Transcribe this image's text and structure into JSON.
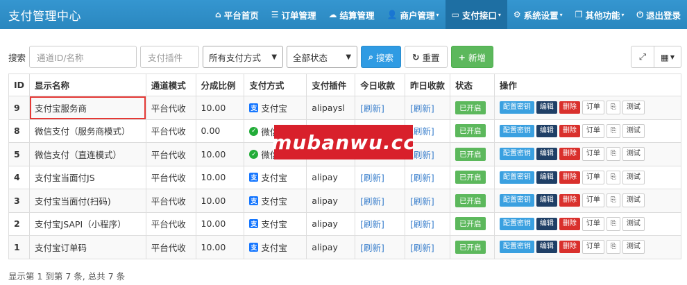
{
  "app": {
    "title": "支付管理中心"
  },
  "nav": [
    {
      "icon": "home-icon",
      "glyph": "⌂",
      "label": "平台首页",
      "caret": false
    },
    {
      "icon": "list-icon",
      "glyph": "☰",
      "label": "订单管理",
      "caret": false
    },
    {
      "icon": "cloud-icon",
      "glyph": "☁",
      "label": "结算管理",
      "caret": false
    },
    {
      "icon": "user-icon",
      "glyph": "👤",
      "label": "商户管理",
      "caret": true
    },
    {
      "icon": "credit-card-icon",
      "glyph": "▭",
      "label": "支付接口",
      "caret": true
    },
    {
      "icon": "gear-icon",
      "glyph": "⚙",
      "label": "系统设置",
      "caret": true
    },
    {
      "icon": "cube-icon",
      "glyph": "❒",
      "label": "其他功能",
      "caret": true
    },
    {
      "icon": "power-icon",
      "glyph": "⏻",
      "label": "退出登录",
      "caret": false
    }
  ],
  "toolbar": {
    "search_label": "搜索",
    "channel_placeholder": "通道ID/名称",
    "plugin_placeholder": "支付插件",
    "method_select": "所有支付方式",
    "status_select": "全部状态",
    "search_btn": "搜索",
    "reset_btn": "重置",
    "add_btn": "新增"
  },
  "table": {
    "headers": [
      "ID",
      "显示名称",
      "通道模式",
      "分成比例",
      "支付方式",
      "支付插件",
      "今日收款",
      "昨日收款",
      "状态",
      "操作"
    ],
    "rows": [
      {
        "id": "9",
        "name": "支付宝服务商",
        "mode": "平台代收",
        "ratio": "10.00",
        "pay": "支付宝",
        "pay_type": "alipay",
        "plugin": "alipaysl",
        "today": "[刷新]",
        "yesterday": "[刷新]",
        "status": "已开启"
      },
      {
        "id": "8",
        "name": "微信支付（服务商模式）",
        "mode": "平台代收",
        "ratio": "0.00",
        "pay": "微信支付",
        "pay_type": "wxpay",
        "plugin": "wxpaysl",
        "today": "[刷新]",
        "yesterday": "[刷新]",
        "status": "已开启"
      },
      {
        "id": "5",
        "name": "微信支付（直连模式）",
        "mode": "平台代收",
        "ratio": "10.00",
        "pay": "微信支付",
        "pay_type": "wxpay",
        "plugin": "wxpay",
        "today": "[刷新]",
        "yesterday": "[刷新]",
        "status": "已开启"
      },
      {
        "id": "4",
        "name": "支付宝当面付JS",
        "mode": "平台代收",
        "ratio": "10.00",
        "pay": "支付宝",
        "pay_type": "alipay",
        "plugin": "alipay",
        "today": "[刷新]",
        "yesterday": "[刷新]",
        "status": "已开启"
      },
      {
        "id": "3",
        "name": "支付宝当面付(扫码)",
        "mode": "平台代收",
        "ratio": "10.00",
        "pay": "支付宝",
        "pay_type": "alipay",
        "plugin": "alipay",
        "today": "[刷新]",
        "yesterday": "[刷新]",
        "status": "已开启"
      },
      {
        "id": "2",
        "name": "支付宝JSAPI（小程序）",
        "mode": "平台代收",
        "ratio": "10.00",
        "pay": "支付宝",
        "pay_type": "alipay",
        "plugin": "alipay",
        "today": "[刷新]",
        "yesterday": "[刷新]",
        "status": "已开启"
      },
      {
        "id": "1",
        "name": "支付宝订单码",
        "mode": "平台代收",
        "ratio": "10.00",
        "pay": "支付宝",
        "pay_type": "alipay",
        "plugin": "alipay",
        "today": "[刷新]",
        "yesterday": "[刷新]",
        "status": "已开启"
      }
    ],
    "ops": {
      "config": "配置密钥",
      "edit": "编辑",
      "delete": "删除",
      "orders": "订单",
      "copy": "⎘",
      "test": "测试"
    }
  },
  "footer": {
    "summary": "显示第 1 到第 7 条, 总共 7 条"
  },
  "watermark": {
    "text": "mubanwu.cc"
  },
  "colors": {
    "navbar": "#2e8fc9",
    "primary": "#2f9be3",
    "success": "#5cb85c",
    "danger": "#d9302c",
    "highlight": "#e53935"
  }
}
